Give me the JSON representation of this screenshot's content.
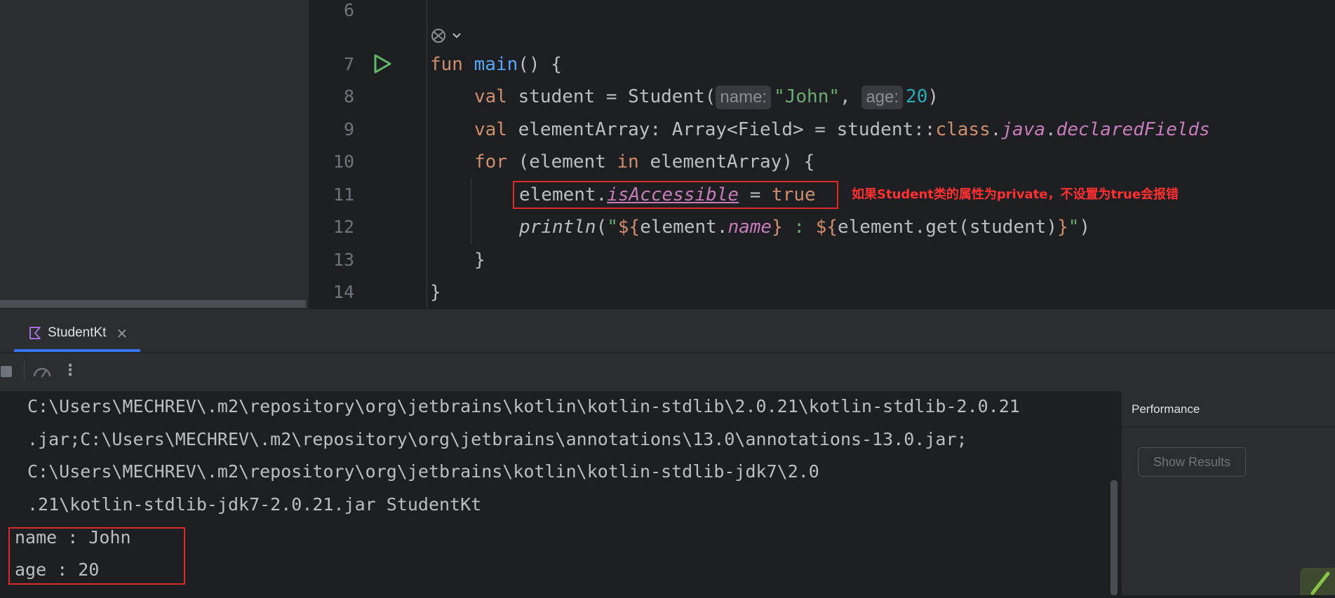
{
  "editor": {
    "lines": [
      {
        "num": "6"
      },
      {
        "num": "7"
      },
      {
        "num": "8"
      },
      {
        "num": "9"
      },
      {
        "num": "10"
      },
      {
        "num": "11"
      },
      {
        "num": "12"
      },
      {
        "num": "13"
      },
      {
        "num": "14"
      }
    ],
    "code": {
      "l7_fun": "fun",
      "l7_main": "main",
      "l7_rest": "() {",
      "l8_val": "val",
      "l8_a": " student = Student(",
      "l8_hint_name": "name:",
      "l8_john": "\"John\"",
      "l8_comma": ", ",
      "l8_hint_age": "age:",
      "l8_20": "20",
      "l8_close": ")",
      "l9_val": "val",
      "l9_a": " elementArray: Array<Field> = student::",
      "l9_class": "class",
      "l9_dot": ".",
      "l9_java": "java",
      "l9_dot2": ".",
      "l9_declared": "declaredFields",
      "l10_for": "for",
      "l10_a": " (element ",
      "l10_in": "in",
      "l10_b": " elementArray) {",
      "l11_a": "element.",
      "l11_prop": "isAccessible",
      "l11_b": " = ",
      "l11_true": "true",
      "l12_println": "println",
      "l12_a": "(",
      "l12_q1": "\"",
      "l12_d1": "${",
      "l12_b": "element.",
      "l12_name": "name",
      "l12_c1": "}",
      "l12_colon": " : ",
      "l12_d2": "${",
      "l12_c": "element.get(student)",
      "l12_c2": "}",
      "l12_q2": "\"",
      "l12_close": ")",
      "l13": "}",
      "l14": "}"
    },
    "annotation": "如果Student类的属性为private，不设置为true会报错"
  },
  "run": {
    "tab_label": "StudentKt",
    "close_glyph": "×",
    "more_glyph": "⋮"
  },
  "console": {
    "lines": [
      "C:\\Users\\MECHREV\\.m2\\repository\\org\\jetbrains\\kotlin\\kotlin-stdlib\\2.0.21\\kotlin-stdlib-2.0.21",
      ".jar;C:\\Users\\MECHREV\\.m2\\repository\\org\\jetbrains\\annotations\\13.0\\annotations-13.0.jar;",
      "C:\\Users\\MECHREV\\.m2\\repository\\org\\jetbrains\\kotlin\\kotlin-stdlib-jdk7\\2.0",
      ".21\\kotlin-stdlib-jdk7-2.0.21.jar StudentKt",
      "name : John",
      "age : 20"
    ]
  },
  "performance": {
    "title": "Performance",
    "show_results": "Show Results"
  },
  "colors": {
    "accent": "#3574f0",
    "highlight": "#e02929",
    "run_icon": "#5fb865"
  }
}
